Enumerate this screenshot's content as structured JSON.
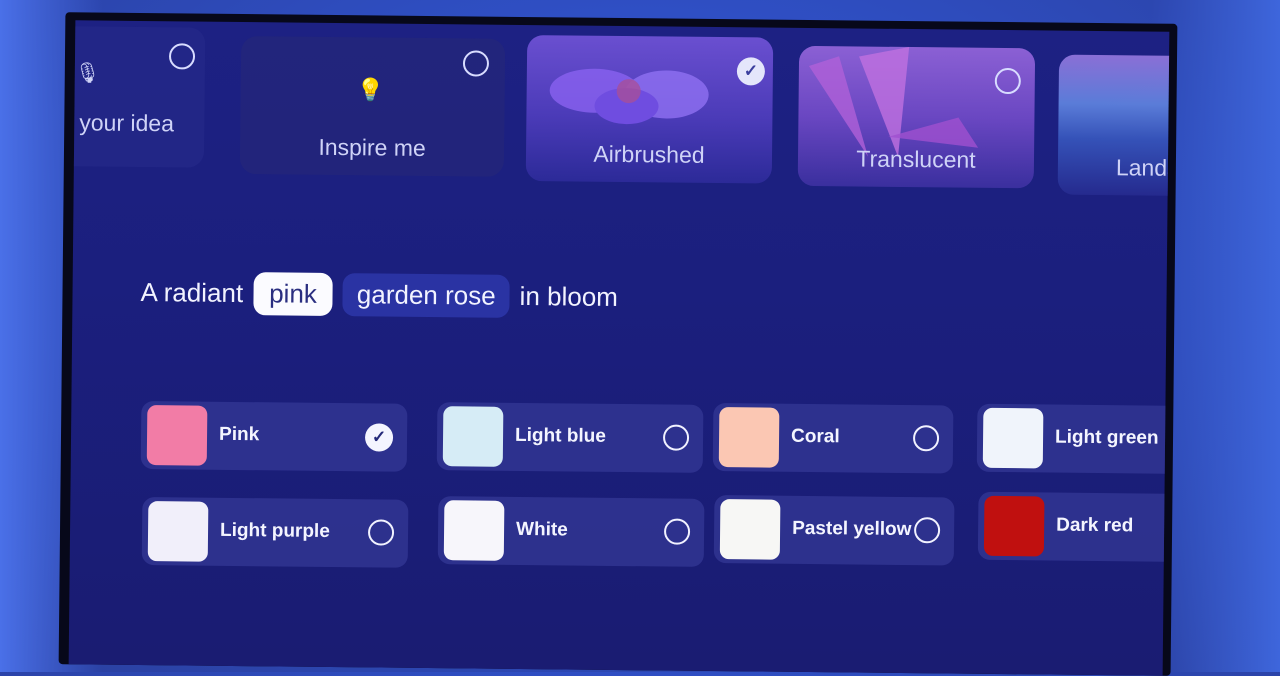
{
  "app": "Generative AI Wallpaper Creator (TV)",
  "styles": [
    {
      "label": "your idea",
      "icon": "microphone-icon",
      "selected": false
    },
    {
      "label": "Inspire me",
      "icon": "lightbulb-sparkle-icon",
      "selected": false
    },
    {
      "label": "Airbrushed",
      "icon": "flower-thumbnail",
      "selected": true
    },
    {
      "label": "Translucent",
      "icon": "flower-thumbnail",
      "selected": false
    },
    {
      "label": "Lands",
      "icon": "landscape-thumbnail",
      "selected": false
    }
  ],
  "prompt": {
    "prefix": "A radiant",
    "chip_selected": "pink",
    "chip_other": "garden rose",
    "suffix": "in bloom"
  },
  "colors": [
    {
      "name": "Pink",
      "swatch": "#f27ca6",
      "selected": true
    },
    {
      "name": "Light blue",
      "swatch": "#d6ecf6",
      "selected": false
    },
    {
      "name": "Coral",
      "swatch": "#fbc7b3",
      "selected": false
    },
    {
      "name": "Light green",
      "swatch": "#f0f4fb",
      "selected": false
    },
    {
      "name": "Light purple",
      "swatch": "#f1effa",
      "selected": false
    },
    {
      "name": "White",
      "swatch": "#f7f6fb",
      "selected": false
    },
    {
      "name": "Pastel yellow",
      "swatch": "#f7f7f5",
      "selected": false
    },
    {
      "name": "Dark red",
      "swatch": "#c0100f",
      "selected": false
    }
  ]
}
